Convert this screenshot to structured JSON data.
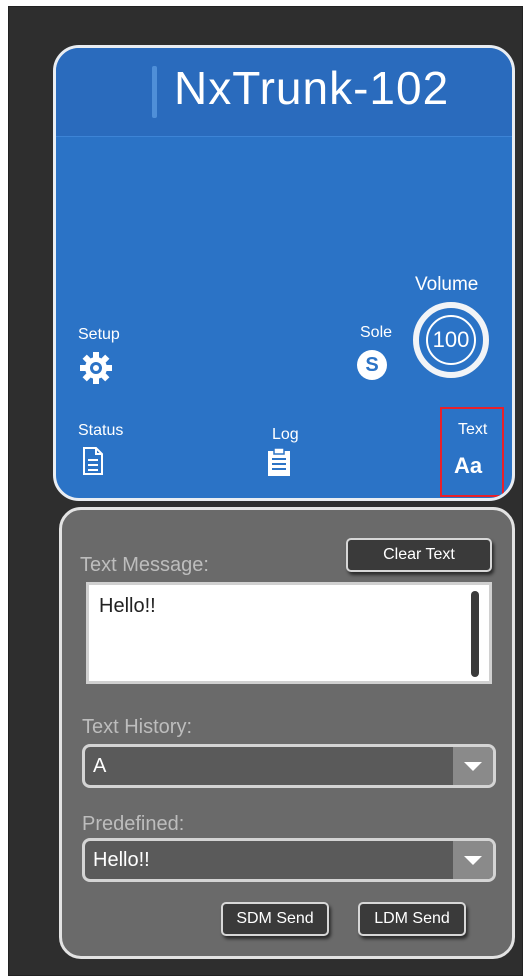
{
  "device": {
    "name": "NxTrunk-102"
  },
  "controls": {
    "setup_label": "Setup",
    "sole_label": "Sole",
    "sole_icon_letter": "S",
    "volume_label": "Volume",
    "volume_value": "100",
    "status_label": "Status",
    "log_label": "Log",
    "text_label": "Text",
    "text_icon_glyph": "Aa"
  },
  "text_panel": {
    "message_label": "Text Message:",
    "clear_button": "Clear Text",
    "message_value": "Hello!!",
    "history_label": "Text History:",
    "history_value": "A",
    "predefined_label": "Predefined:",
    "predefined_value": "Hello!!",
    "sdm_send": "SDM Send",
    "ldm_send": "LDM Send"
  },
  "colors": {
    "panel_blue": "#2b73c6",
    "panel_grey": "#6a6a6a",
    "highlight_red": "#e8202a",
    "background_dark": "#2e2e2e"
  }
}
